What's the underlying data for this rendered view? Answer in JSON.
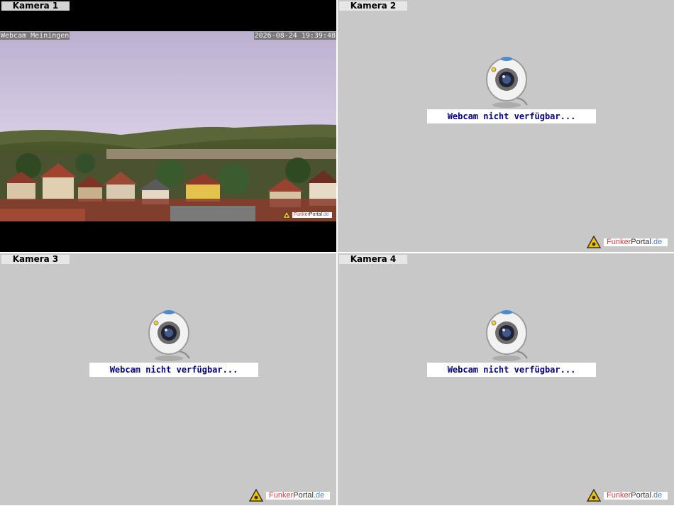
{
  "panels": [
    {
      "label": "Kamera 1",
      "overlay_title": "Webcam Meiningen",
      "timestamp": "2026-08-24 19:39:48",
      "status": "live"
    },
    {
      "label": "Kamera 2",
      "message": "Webcam nicht verfügbar...",
      "status": "unavailable"
    },
    {
      "label": "Kamera 3",
      "message": "Webcam nicht verfügbar...",
      "status": "unavailable"
    },
    {
      "label": "Kamera 4",
      "message": "Webcam nicht verfügbar...",
      "status": "unavailable"
    }
  ],
  "brand": {
    "part1": "Funk",
    "part2": "er",
    "part3": "Portal",
    "part4": ".de"
  },
  "colors": {
    "panel_bg": "#c8c8c8",
    "message_text": "#00008a",
    "brand_red": "#d93a3a",
    "brand_blue": "#4b7fd0"
  },
  "icons": [
    "webcam-icon",
    "warning-triangle-icon"
  ]
}
